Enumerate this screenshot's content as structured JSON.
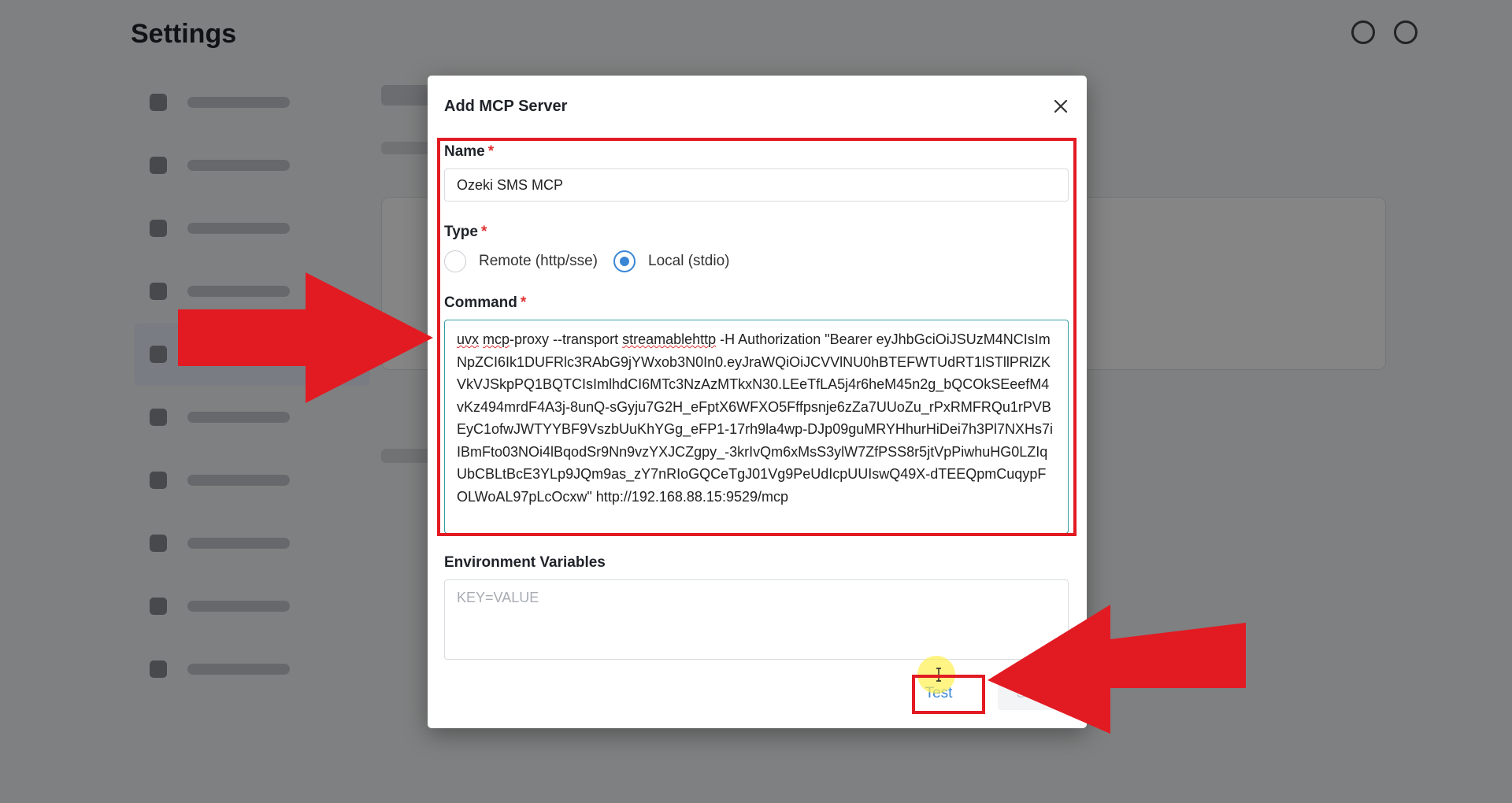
{
  "background": {
    "page_title": "Settings"
  },
  "modal": {
    "title": "Add MCP Server",
    "name_field": {
      "label": "Name",
      "required_mark": "*",
      "value": "Ozeki SMS MCP"
    },
    "type_field": {
      "label": "Type",
      "required_mark": "*",
      "options": [
        {
          "label": "Remote (http/sse)",
          "selected": false
        },
        {
          "label": "Local (stdio)",
          "selected": true
        }
      ]
    },
    "command_field": {
      "label": "Command",
      "required_mark": "*",
      "value_part1": "uvx",
      "value_part2": " ",
      "value_part3": "mcp",
      "value_part4": "-proxy --transport ",
      "value_part5": "streamablehttp",
      "value_part6": " -H Authorization \"Bearer eyJhbGciOiJSUzM4NCIsImNpZCI6Ik1DUFRlc3RAbG9jYWxob3N0In0.eyJraWQiOiJCVVlNU0hBTEFWTUdRT1lSTllPRlZKVkVJSkpPQ1BQTCIsImlhdCI6MTc3NzAzMTkxN30.LEeTfLA5j4r6heM45n2g_bQCOkSEeefM4vKz494mrdF4A3j-8unQ-sGyju7G2H_eFptX6WFXO5Fffpsnje6zZa7UUoZu_rPxRMFRQu1rPVBEyC1ofwJWTYYBF9VszbUuKhYGg_eFP1-17rh9la4wp-DJp09guMRYHhurHiDei7h3Pl7NXHs7iIBmFto03NOi4lBqodSr9Nn9vzYXJCZgpy_-3krIvQm6xMsS3ylW7ZfPSS8r5jtVpPiwhuHG0LZIqUbCBLtBcE3YLp9JQm9as_zY7nRIoGQCeTgJ01Vg9PeUdIcpUUIswQ49X-dTEEQpmCuqypFOLWoAL97pLcOcxw\" http://192.168.88.15:9529/mcp"
    },
    "env_field": {
      "label": "Environment Variables",
      "placeholder": "KEY=VALUE"
    },
    "buttons": {
      "test_label": "Test",
      "save_label": "Save"
    },
    "colors": {
      "accent": "#3a86d6",
      "required": "#e03131",
      "annotation": "#e21b23"
    }
  }
}
